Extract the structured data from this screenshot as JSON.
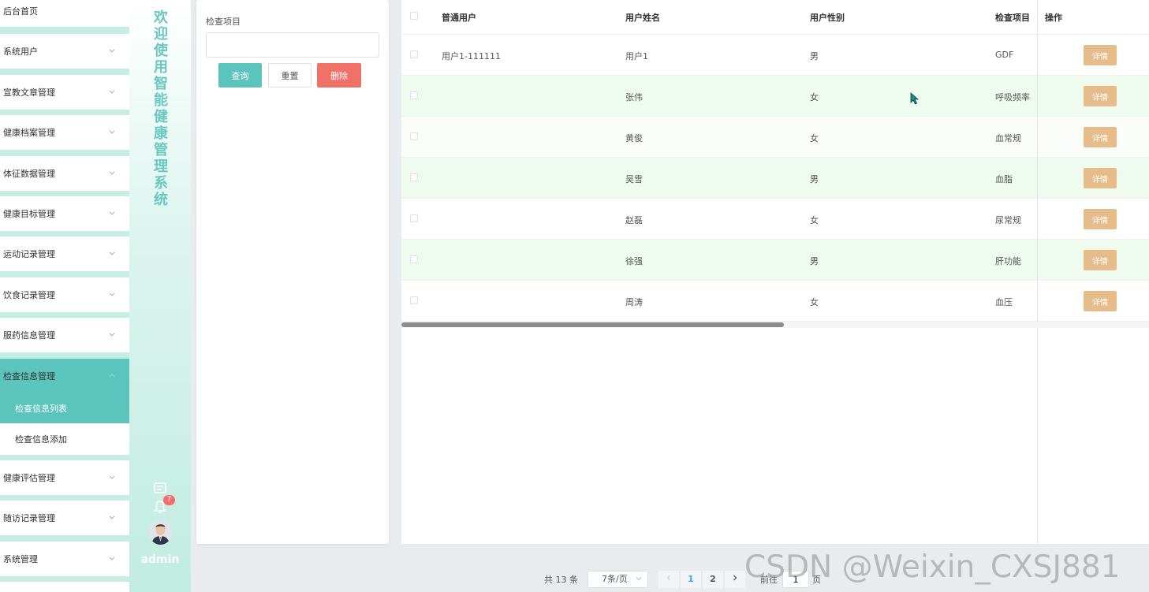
{
  "menu": {
    "items": [
      {
        "label": "后台首页"
      },
      {
        "label": "系统用户"
      },
      {
        "label": "宣教文章管理"
      },
      {
        "label": "健康档案管理"
      },
      {
        "label": "体征数据管理"
      },
      {
        "label": "健康目标管理"
      },
      {
        "label": "运动记录管理"
      },
      {
        "label": "饮食记录管理"
      },
      {
        "label": "服药信息管理"
      },
      {
        "label": "检查信息管理"
      },
      {
        "label": "健康评估管理"
      },
      {
        "label": "随访记录管理"
      },
      {
        "label": "系统管理"
      }
    ],
    "sub_items": [
      {
        "label": "检查信息列表"
      },
      {
        "label": "检查信息添加"
      }
    ]
  },
  "welcome": {
    "title": "欢迎使用智能健康管理系统",
    "badge": "7",
    "username": "admin"
  },
  "search": {
    "field_label": "检查项目",
    "field_value": "",
    "query_label": "查询",
    "reset_label": "重置",
    "delete_label": "删除"
  },
  "table": {
    "headers": {
      "user": "普通用户",
      "name": "用户姓名",
      "gender": "用户性别",
      "item": "检查项目",
      "action": "操作"
    },
    "detail_label": "详情",
    "rows": [
      {
        "user": "用户1-111111",
        "name": "用户1",
        "gender": "男",
        "item": "GDF"
      },
      {
        "user": "",
        "name": "张伟",
        "gender": "女",
        "item": "呼吸频率"
      },
      {
        "user": "",
        "name": "黄俊",
        "gender": "女",
        "item": "血常规"
      },
      {
        "user": "",
        "name": "吴雪",
        "gender": "男",
        "item": "血脂"
      },
      {
        "user": "",
        "name": "赵磊",
        "gender": "女",
        "item": "尿常规"
      },
      {
        "user": "",
        "name": "徐强",
        "gender": "男",
        "item": "肝功能"
      },
      {
        "user": "",
        "name": "周涛",
        "gender": "女",
        "item": "血压"
      }
    ]
  },
  "pagination": {
    "total": "共 13 条",
    "page_size": "7条/页",
    "pages": [
      "1",
      "2"
    ],
    "current_page": "1",
    "goto_label": "前往",
    "goto_value": "1",
    "page_suffix": "页"
  },
  "watermark": "CSDN @Weixin_CXSJ881",
  "colors": {
    "accent": "#5bc4bd",
    "danger": "#f07167",
    "detail": "#e6bd8a",
    "row_stripe": "#f0fbf0"
  }
}
